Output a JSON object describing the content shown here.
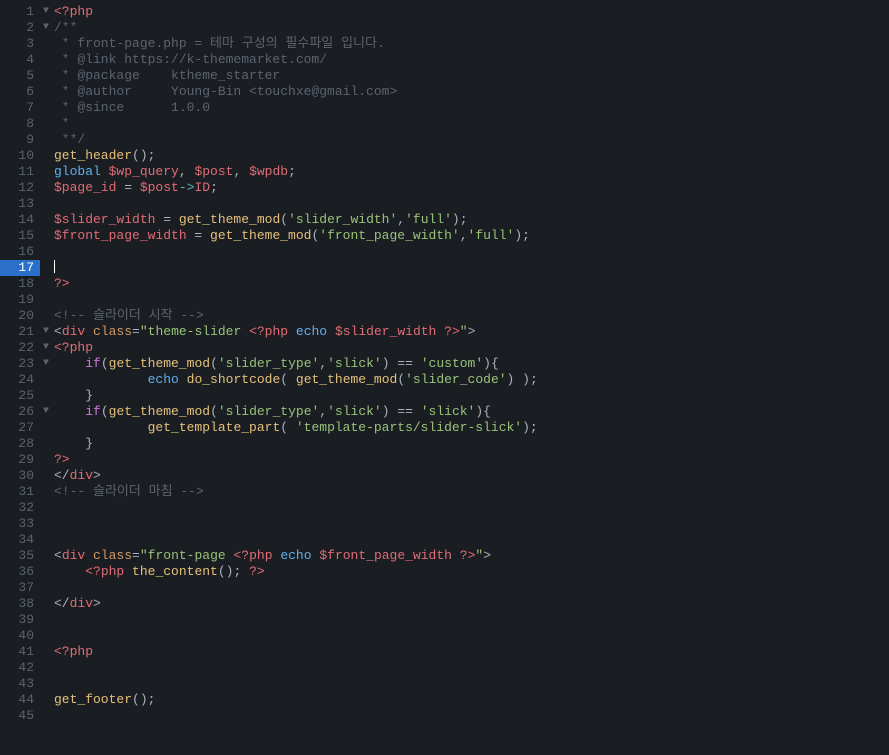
{
  "editor": {
    "total_lines": 45,
    "active_line": 17,
    "fold_markers": {
      "1": "▼",
      "2": "▼",
      "21": "▼",
      "22": "▼",
      "23": "▼",
      "26": "▼"
    },
    "lines": [
      {
        "n": 1,
        "t": [
          [
            "c-tag",
            "<?php"
          ]
        ]
      },
      {
        "n": 2,
        "t": [
          [
            "c-com",
            "/**"
          ]
        ]
      },
      {
        "n": 3,
        "t": [
          [
            "c-com",
            " * front-page.php = 테마 구성의 필수파일 입니다."
          ]
        ]
      },
      {
        "n": 4,
        "t": [
          [
            "c-com",
            " * @link https://k-thememarket.com/"
          ]
        ]
      },
      {
        "n": 5,
        "t": [
          [
            "c-com",
            " * @package    ktheme_starter"
          ]
        ]
      },
      {
        "n": 6,
        "t": [
          [
            "c-com",
            " * @author     Young-Bin <touchxe@gmail.com>"
          ]
        ]
      },
      {
        "n": 7,
        "t": [
          [
            "c-com",
            " * @since      1.0.0"
          ]
        ]
      },
      {
        "n": 8,
        "t": [
          [
            "c-com",
            " *"
          ]
        ]
      },
      {
        "n": 9,
        "t": [
          [
            "c-com",
            " **/"
          ]
        ]
      },
      {
        "n": 10,
        "t": [
          [
            "c-fn",
            "get_header"
          ],
          [
            "c-punct",
            "();"
          ]
        ]
      },
      {
        "n": 11,
        "t": [
          [
            "c-kw",
            "global "
          ],
          [
            "c-var",
            "$wp_query"
          ],
          [
            "c-punct",
            ", "
          ],
          [
            "c-var",
            "$post"
          ],
          [
            "c-punct",
            ", "
          ],
          [
            "c-var",
            "$wpdb"
          ],
          [
            "c-punct",
            ";"
          ]
        ]
      },
      {
        "n": 12,
        "t": [
          [
            "c-var",
            "$page_id"
          ],
          [
            "c-punct",
            " = "
          ],
          [
            "c-var",
            "$post"
          ],
          [
            "c-op",
            "->"
          ],
          [
            "c-prop",
            "ID"
          ],
          [
            "c-punct",
            ";"
          ]
        ]
      },
      {
        "n": 13,
        "t": []
      },
      {
        "n": 14,
        "t": [
          [
            "c-var",
            "$slider_width"
          ],
          [
            "c-punct",
            " = "
          ],
          [
            "c-fn",
            "get_theme_mod"
          ],
          [
            "c-punct",
            "("
          ],
          [
            "c-str",
            "'slider_width'"
          ],
          [
            "c-punct",
            ","
          ],
          [
            "c-str",
            "'full'"
          ],
          [
            "c-punct",
            ");"
          ]
        ]
      },
      {
        "n": 15,
        "t": [
          [
            "c-var",
            "$front_page_width"
          ],
          [
            "c-punct",
            " = "
          ],
          [
            "c-fn",
            "get_theme_mod"
          ],
          [
            "c-punct",
            "("
          ],
          [
            "c-str",
            "'front_page_width'"
          ],
          [
            "c-punct",
            ","
          ],
          [
            "c-str",
            "'full'"
          ],
          [
            "c-punct",
            ");"
          ]
        ]
      },
      {
        "n": 16,
        "t": []
      },
      {
        "n": 17,
        "t": [],
        "cursor": true
      },
      {
        "n": 18,
        "t": [
          [
            "c-tag",
            "?>"
          ]
        ]
      },
      {
        "n": 19,
        "t": []
      },
      {
        "n": 20,
        "t": [
          [
            "c-com",
            "<!-- 슬라이더 시작 -->"
          ]
        ]
      },
      {
        "n": 21,
        "t": [
          [
            "c-punct",
            "<"
          ],
          [
            "c-tag",
            "div"
          ],
          [
            "c-punct",
            " "
          ],
          [
            "c-attr",
            "class"
          ],
          [
            "c-punct",
            "="
          ],
          [
            "c-str",
            "\"theme-slider "
          ],
          [
            "c-tag",
            "<?php"
          ],
          [
            "c-punct",
            " "
          ],
          [
            "c-kw",
            "echo"
          ],
          [
            "c-punct",
            " "
          ],
          [
            "c-var",
            "$slider_width"
          ],
          [
            "c-punct",
            " "
          ],
          [
            "c-tag",
            "?>"
          ],
          [
            "c-str",
            "\""
          ],
          [
            "c-punct",
            ">"
          ]
        ]
      },
      {
        "n": 22,
        "t": [
          [
            "c-tag",
            "<?php"
          ]
        ]
      },
      {
        "n": 23,
        "t": [
          [
            "c-punct",
            "    "
          ],
          [
            "c-kw2",
            "if"
          ],
          [
            "c-punct",
            "("
          ],
          [
            "c-fn",
            "get_theme_mod"
          ],
          [
            "c-punct",
            "("
          ],
          [
            "c-str",
            "'slider_type'"
          ],
          [
            "c-punct",
            ","
          ],
          [
            "c-str",
            "'slick'"
          ],
          [
            "c-punct",
            ") == "
          ],
          [
            "c-str",
            "'custom'"
          ],
          [
            "c-punct",
            "){"
          ]
        ]
      },
      {
        "n": 24,
        "t": [
          [
            "c-punct",
            "            "
          ],
          [
            "c-kw",
            "echo"
          ],
          [
            "c-punct",
            " "
          ],
          [
            "c-fn",
            "do_shortcode"
          ],
          [
            "c-punct",
            "( "
          ],
          [
            "c-fn",
            "get_theme_mod"
          ],
          [
            "c-punct",
            "("
          ],
          [
            "c-str",
            "'slider_code'"
          ],
          [
            "c-punct",
            ") );"
          ]
        ]
      },
      {
        "n": 25,
        "t": [
          [
            "c-punct",
            "    }"
          ]
        ]
      },
      {
        "n": 26,
        "t": [
          [
            "c-punct",
            "    "
          ],
          [
            "c-kw2",
            "if"
          ],
          [
            "c-punct",
            "("
          ],
          [
            "c-fn",
            "get_theme_mod"
          ],
          [
            "c-punct",
            "("
          ],
          [
            "c-str",
            "'slider_type'"
          ],
          [
            "c-punct",
            ","
          ],
          [
            "c-str",
            "'slick'"
          ],
          [
            "c-punct",
            ") == "
          ],
          [
            "c-str",
            "'slick'"
          ],
          [
            "c-punct",
            "){"
          ]
        ]
      },
      {
        "n": 27,
        "t": [
          [
            "c-punct",
            "            "
          ],
          [
            "c-fn",
            "get_template_part"
          ],
          [
            "c-punct",
            "( "
          ],
          [
            "c-str",
            "'template-parts/slider-slick'"
          ],
          [
            "c-punct",
            ");"
          ]
        ]
      },
      {
        "n": 28,
        "t": [
          [
            "c-punct",
            "    }"
          ]
        ]
      },
      {
        "n": 29,
        "t": [
          [
            "c-tag",
            "?>"
          ]
        ]
      },
      {
        "n": 30,
        "t": [
          [
            "c-punct",
            "</"
          ],
          [
            "c-tag",
            "div"
          ],
          [
            "c-punct",
            ">"
          ]
        ]
      },
      {
        "n": 31,
        "t": [
          [
            "c-com",
            "<!-- 슬라이더 마침 -->"
          ]
        ]
      },
      {
        "n": 32,
        "t": []
      },
      {
        "n": 33,
        "t": []
      },
      {
        "n": 34,
        "t": []
      },
      {
        "n": 35,
        "t": [
          [
            "c-punct",
            "<"
          ],
          [
            "c-tag",
            "div"
          ],
          [
            "c-punct",
            " "
          ],
          [
            "c-attr",
            "class"
          ],
          [
            "c-punct",
            "="
          ],
          [
            "c-str",
            "\"front-page "
          ],
          [
            "c-tag",
            "<?php"
          ],
          [
            "c-punct",
            " "
          ],
          [
            "c-kw",
            "echo"
          ],
          [
            "c-punct",
            " "
          ],
          [
            "c-var",
            "$front_page_width"
          ],
          [
            "c-punct",
            " "
          ],
          [
            "c-tag",
            "?>"
          ],
          [
            "c-str",
            "\""
          ],
          [
            "c-punct",
            ">"
          ]
        ]
      },
      {
        "n": 36,
        "t": [
          [
            "c-punct",
            "    "
          ],
          [
            "c-tag",
            "<?php"
          ],
          [
            "c-punct",
            " "
          ],
          [
            "c-fn",
            "the_content"
          ],
          [
            "c-punct",
            "(); "
          ],
          [
            "c-tag",
            "?>"
          ]
        ]
      },
      {
        "n": 37,
        "t": []
      },
      {
        "n": 38,
        "t": [
          [
            "c-punct",
            "</"
          ],
          [
            "c-tag",
            "div"
          ],
          [
            "c-punct",
            ">"
          ]
        ]
      },
      {
        "n": 39,
        "t": []
      },
      {
        "n": 40,
        "t": []
      },
      {
        "n": 41,
        "t": [
          [
            "c-tag",
            "<?php"
          ]
        ]
      },
      {
        "n": 42,
        "t": []
      },
      {
        "n": 43,
        "t": []
      },
      {
        "n": 44,
        "t": [
          [
            "c-fn",
            "get_footer"
          ],
          [
            "c-punct",
            "();"
          ]
        ]
      },
      {
        "n": 45,
        "t": []
      }
    ]
  }
}
